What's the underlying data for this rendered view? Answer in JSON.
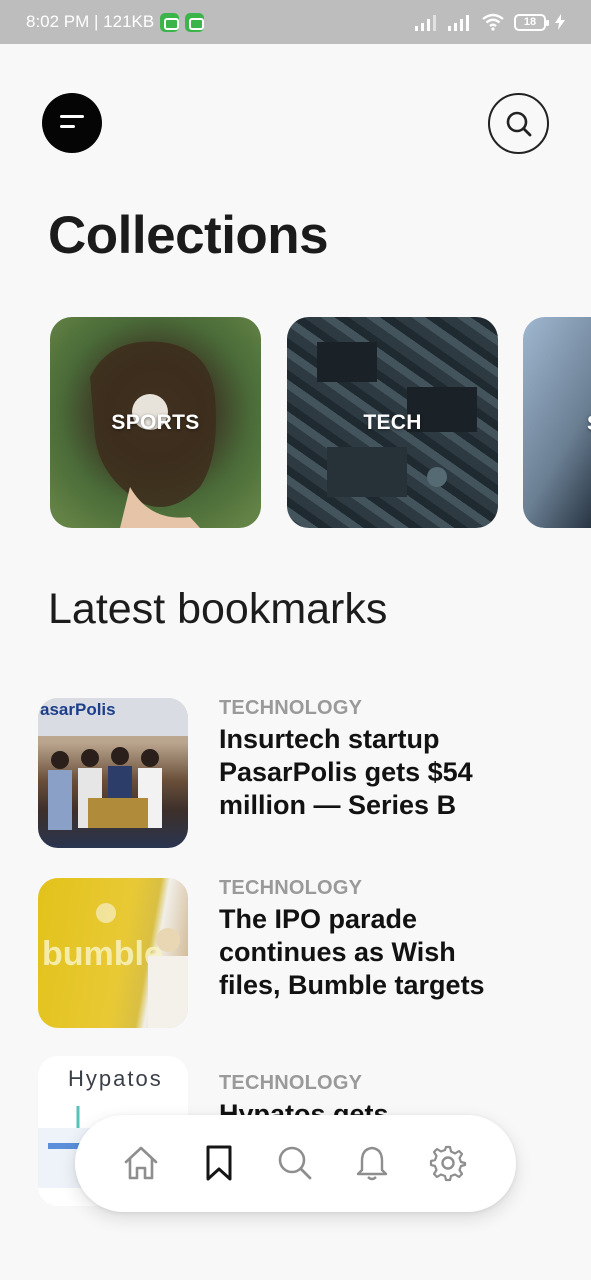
{
  "status_bar": {
    "time_and_data": "8:02 PM | 121KB",
    "battery_level": "18"
  },
  "header": {
    "title": "Collections",
    "menu_icon": "menu-icon",
    "search_icon": "search-icon"
  },
  "collections": [
    {
      "label": "SPORTS"
    },
    {
      "label": "TECH"
    },
    {
      "label": "S"
    }
  ],
  "bookmarks_section": {
    "title": "Latest bookmarks",
    "items": [
      {
        "category": "TECHNOLOGY",
        "headline": "Insurtech startup PasarPolis gets $54 million — Series B",
        "thumb_text": "asarPolis"
      },
      {
        "category": "TECHNOLOGY",
        "headline": "The IPO parade continues as Wish files, Bumble targets",
        "thumb_text": "bumble"
      },
      {
        "category": "TECHNOLOGY",
        "headline": "Hypatos gets",
        "thumb_text": "Hypatos"
      }
    ]
  },
  "bottom_nav": {
    "items": [
      {
        "icon": "home-icon",
        "active": false
      },
      {
        "icon": "bookmark-icon",
        "active": true
      },
      {
        "icon": "search-icon",
        "active": false
      },
      {
        "icon": "bell-icon",
        "active": false
      },
      {
        "icon": "gear-icon",
        "active": false
      }
    ]
  }
}
